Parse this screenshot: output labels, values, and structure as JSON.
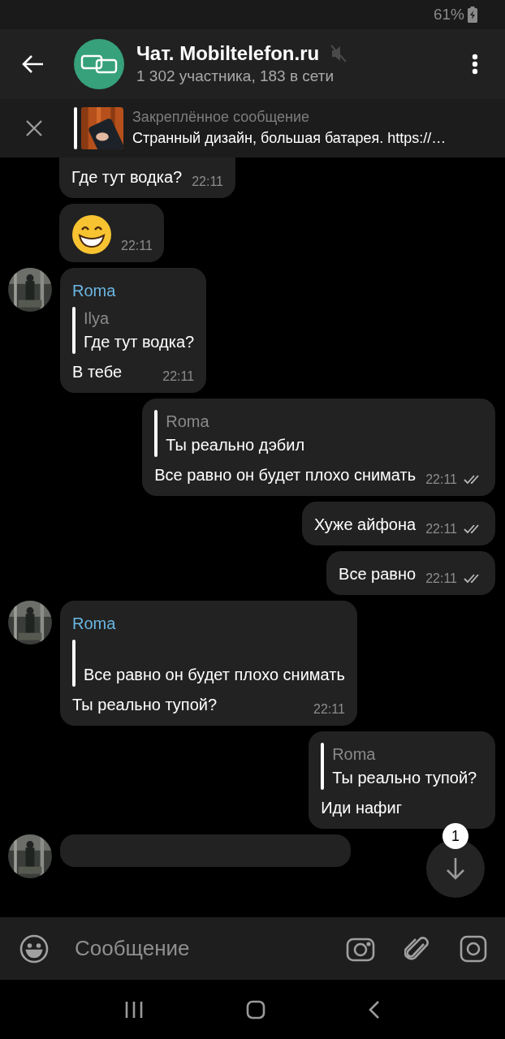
{
  "status_bar": {
    "battery": "61%"
  },
  "header": {
    "title": "Чат. Mobiltelefon.ru",
    "muted": true,
    "subtitle": "1 302 участника, 183 в сети"
  },
  "pinned": {
    "label": "Закреплённое сообщение",
    "text": "Странный дизайн, большая батарея. https://…"
  },
  "messages": [
    {
      "kind": "incoming",
      "clipped": true,
      "text": "Где тут водка?",
      "time": "22:11"
    },
    {
      "kind": "emoji",
      "time": "22:11"
    },
    {
      "kind": "incoming",
      "avatar": true,
      "sender": "Roma",
      "reply": {
        "name": "Ilya",
        "text": "Где тут водка?"
      },
      "text": "В тебе",
      "time": "22:11"
    },
    {
      "kind": "outgoing",
      "reply": {
        "name": "Roma",
        "text": "Ты реально дэбил"
      },
      "text": "Все равно он будет плохо снимать",
      "time": "22:11",
      "read": true
    },
    {
      "kind": "outgoing",
      "text": "Хуже айфона",
      "time": "22:11",
      "read": true
    },
    {
      "kind": "outgoing",
      "text": "Все равно",
      "time": "22:11",
      "read": true
    },
    {
      "kind": "incoming",
      "avatar": true,
      "sender": "Roma",
      "reply": {
        "text": "Все равно он будет плохо снимать"
      },
      "text": "Ты реально тупой?",
      "time": "22:11"
    },
    {
      "kind": "outgoing",
      "reply": {
        "name": "Roma",
        "text": "Ты реально тупой?"
      },
      "text": "Иди нафиг"
    },
    {
      "kind": "stub",
      "avatar": true
    }
  ],
  "scroll_button": {
    "badge": "1"
  },
  "composer": {
    "placeholder": "Сообщение"
  }
}
